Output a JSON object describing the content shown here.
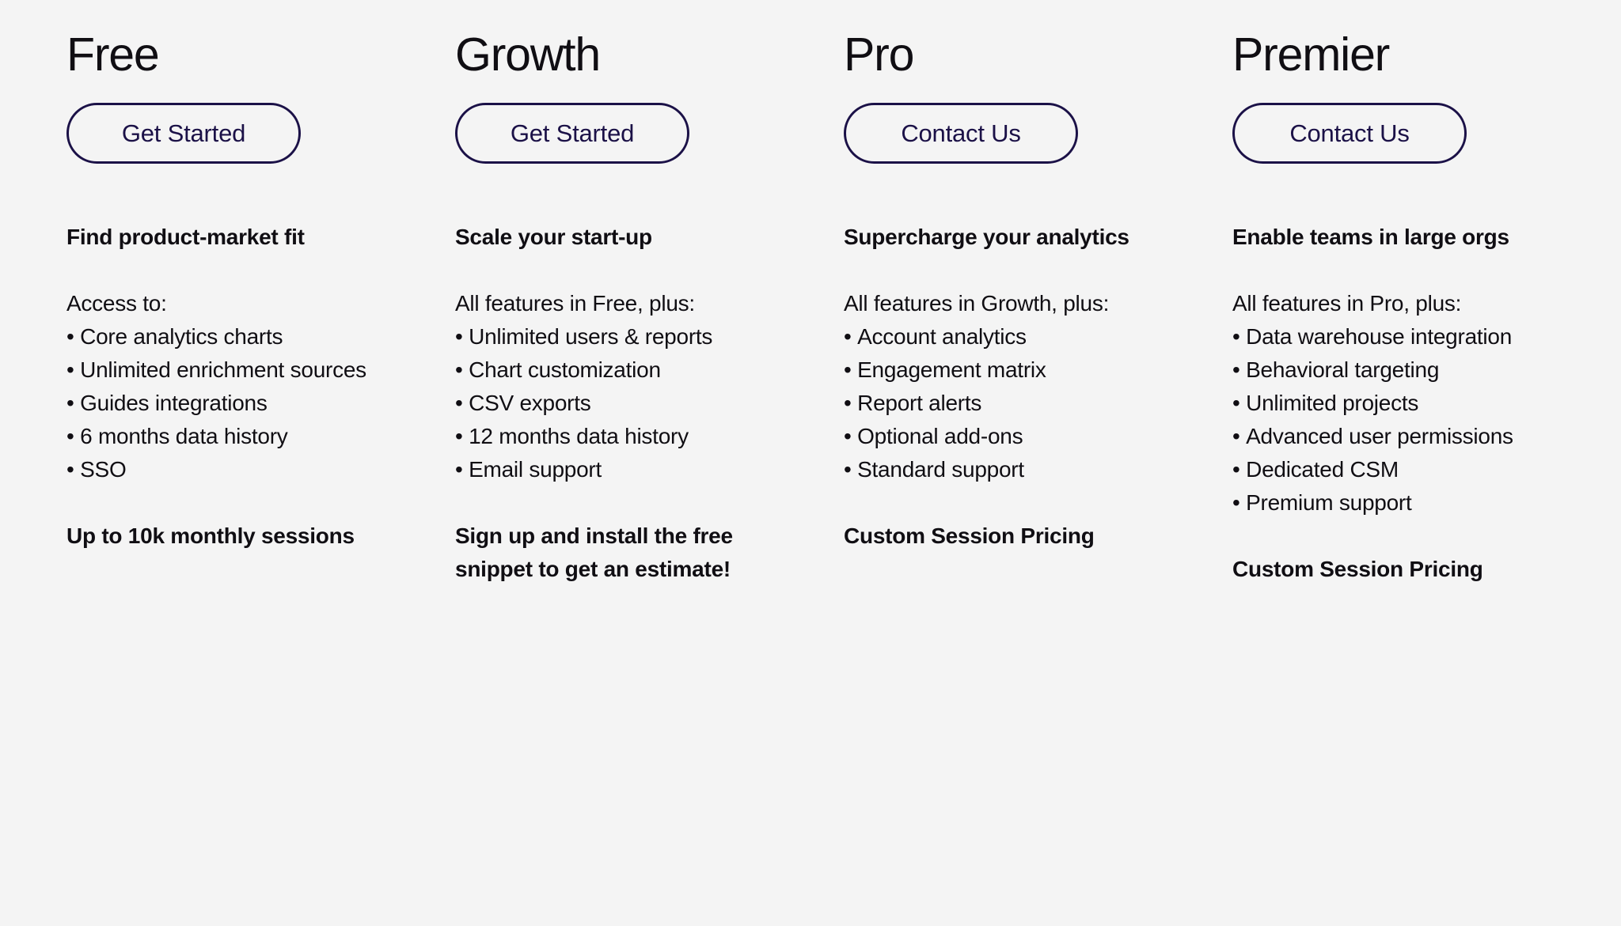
{
  "background_color": "#f4f4f4",
  "accent_color": "#1b1147",
  "text_color": "#100e13",
  "plans": [
    {
      "title": "Free",
      "cta_label": "Get Started",
      "subhead": "Find product-market fit",
      "features_intro": "Access to:",
      "features": [
        "Core analytics charts",
        "Unlimited enrichment sources",
        "Guides integrations",
        "6 months data history",
        "SSO"
      ],
      "footer": "Up to 10k monthly sessions"
    },
    {
      "title": "Growth",
      "cta_label": "Get Started",
      "subhead": "Scale your start-up",
      "features_intro": "All features in Free, plus:",
      "features": [
        "Unlimited users & reports",
        "Chart customization",
        "CSV exports",
        "12 months data history",
        "Email support"
      ],
      "footer": "Sign up and install the free snippet to get an estimate!"
    },
    {
      "title": "Pro",
      "cta_label": "Contact Us",
      "subhead": "Supercharge your analytics",
      "features_intro": "All features in Growth, plus:",
      "features": [
        "Account analytics",
        "Engagement matrix",
        "Report alerts",
        "Optional add-ons",
        "Standard support"
      ],
      "footer": "Custom Session Pricing"
    },
    {
      "title": "Premier",
      "cta_label": "Contact Us",
      "subhead": "Enable teams in large orgs",
      "features_intro": "All features in Pro, plus:",
      "features": [
        "Data warehouse integration",
        "Behavioral targeting",
        "Unlimited projects",
        "Advanced user permissions",
        "Dedicated CSM",
        "Premium support"
      ],
      "footer": "Custom Session Pricing"
    }
  ]
}
